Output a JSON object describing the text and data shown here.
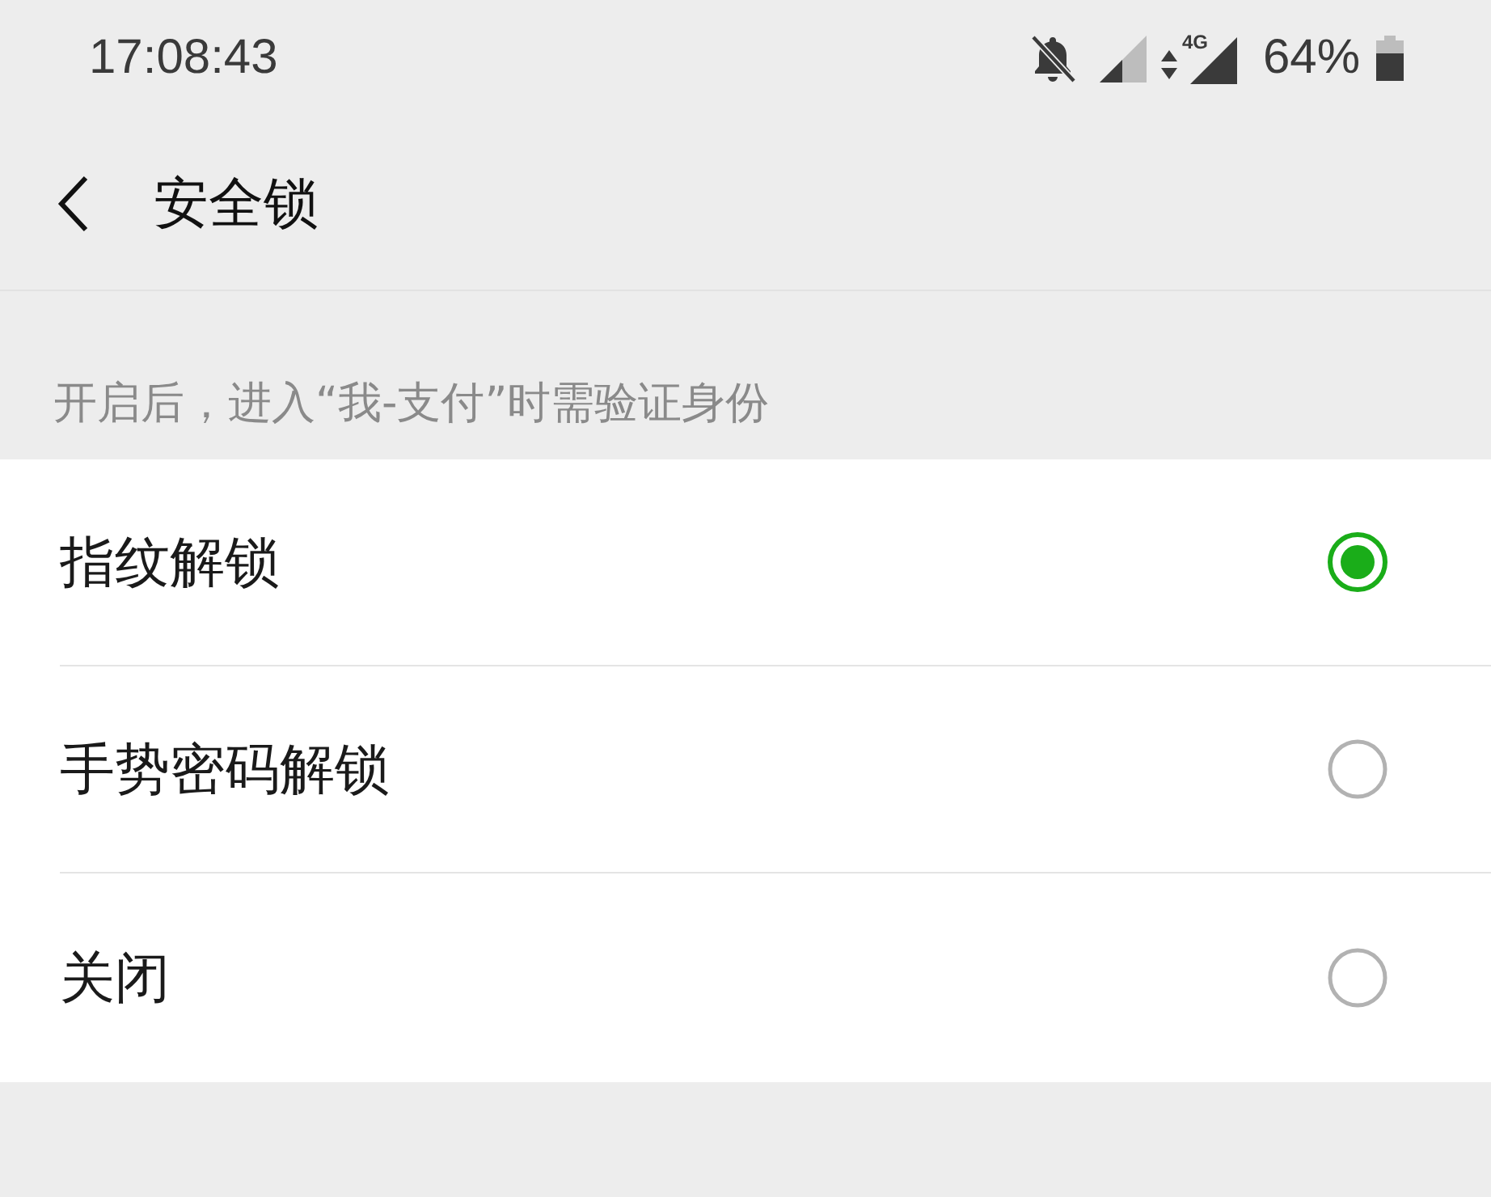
{
  "status_bar": {
    "time": "17:08:43",
    "network_type": "4G",
    "battery": "64%"
  },
  "header": {
    "title": "安全锁"
  },
  "description": "开启后，进入“我-支付”时需验证身份",
  "options": [
    {
      "label": "指纹解锁",
      "selected": true
    },
    {
      "label": "手势密码解锁",
      "selected": false
    },
    {
      "label": "关闭",
      "selected": false
    }
  ]
}
